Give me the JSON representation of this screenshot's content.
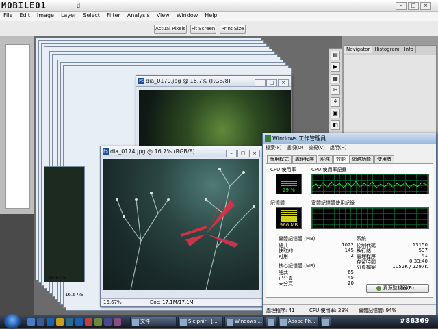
{
  "app": {
    "logo_text": "MOBILE01",
    "title_fragment": "d"
  },
  "menu": [
    "File",
    "Edit",
    "Image",
    "Layer",
    "Select",
    "Filter",
    "Analysis",
    "View",
    "Window",
    "Help"
  ],
  "options_bar": {
    "actual_pixels": "Actual Pixels",
    "fit_screen": "Fit Screen",
    "print_size": "Print Size"
  },
  "documents": {
    "back": {
      "title": "dia_0170.jpg @ 16.7% (RGB/8)"
    },
    "front": {
      "title": "dia_0174.jpg @ 16.7% (RGB/8)",
      "zoom": "16.67%",
      "doc_info": "Doc: 17.1M/17.1M"
    },
    "stack_zoom_1": "16.67%",
    "stack_zoom_2": "16.67%"
  },
  "panels": {
    "navigator": "Navigator",
    "histogram": "Histogram",
    "info": "Info"
  },
  "task_manager": {
    "title": "Windows 工作管理員",
    "menu": [
      "檔案(F)",
      "選項(O)",
      "檢視(V)",
      "說明(H)"
    ],
    "tabs": [
      "應用程式",
      "處理程序",
      "服務",
      "效能",
      "網路功能",
      "使用者"
    ],
    "active_tab": 3,
    "cpu_usage_label": "CPU 使用率",
    "cpu_usage_value": "29 %",
    "cpu_usage_pct": 29,
    "cpu_history_label": "CPU 使用率記錄",
    "memory_label": "記憶體",
    "memory_value": "966 MB",
    "memory_history_label": "實體記憶體使用記錄",
    "physical_memory": {
      "header": "實體記憶體 (MB)",
      "rows": [
        {
          "label": "總共",
          "value": "1022"
        },
        {
          "label": "快取的",
          "value": "145"
        },
        {
          "label": "可用",
          "value": "2"
        }
      ]
    },
    "kernel_memory": {
      "header": "核心記憶體 (MB)",
      "rows": [
        {
          "label": "總共",
          "value": "65"
        },
        {
          "label": "已分頁",
          "value": "45"
        },
        {
          "label": "未分頁",
          "value": "20"
        }
      ]
    },
    "system": {
      "header": "系統",
      "rows": [
        {
          "label": "控制代碼",
          "value": "13150"
        },
        {
          "label": "執行緒",
          "value": "537"
        },
        {
          "label": "處理程序",
          "value": "41"
        },
        {
          "label": "存留時間",
          "value": "0:33:40"
        },
        {
          "label": "分頁檔案",
          "value": "1052K / 2297K"
        }
      ]
    },
    "resource_monitor_button": "資源監視器(R)...",
    "status": {
      "processes": "處理程序: 41",
      "cpu": "CPU 使用率: 29%",
      "memory": "實體記憶體: 94%"
    }
  },
  "taskbar": {
    "items": [
      {
        "label": "文件"
      },
      {
        "label": "Sleipnir - [..."
      },
      {
        "label": "Windows ..."
      },
      {
        "label": ""
      },
      {
        "label": "Adobe Ph..."
      },
      {
        "label": ""
      }
    ],
    "watermark": "#88369"
  }
}
